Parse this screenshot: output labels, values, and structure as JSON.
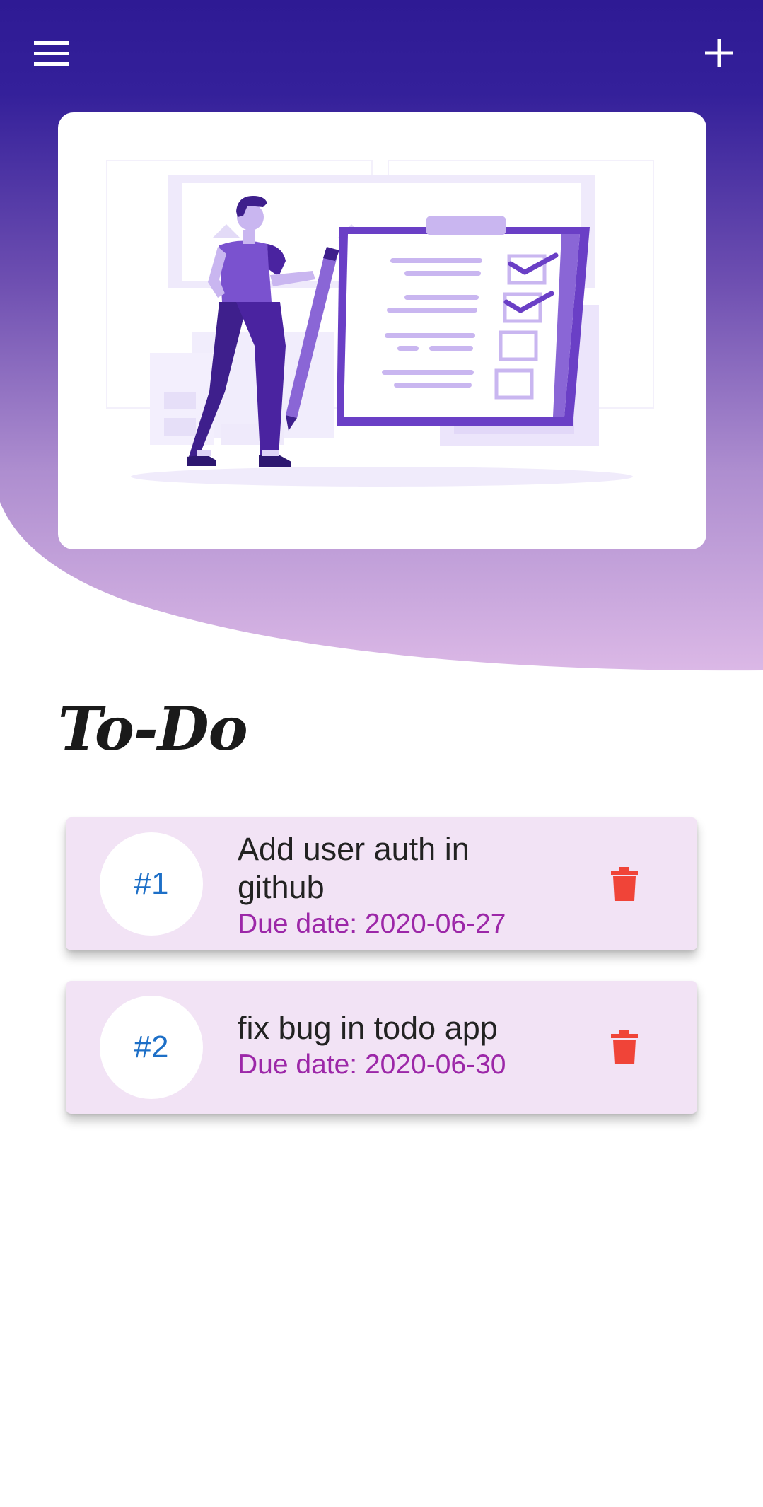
{
  "header": {
    "menu_icon": "menu-icon",
    "add_icon": "add-icon",
    "gradient_top": "#2e1a94",
    "gradient_bottom": "#dab8e5"
  },
  "hero": {
    "illustration": "person-with-checklist-illustration",
    "accent": "#6a3fc6"
  },
  "page_title": "To-Do",
  "todos": [
    {
      "number": "#1",
      "title": "Add user auth in github",
      "due": "Due date: 2020-06-27"
    },
    {
      "number": "#2",
      "title": "fix bug in todo app",
      "due": "Due date: 2020-06-30"
    }
  ],
  "colors": {
    "card_bg": "#f2e3f5",
    "number": "#1d6fc7",
    "due": "#9c27a8",
    "delete": "#f04438"
  }
}
